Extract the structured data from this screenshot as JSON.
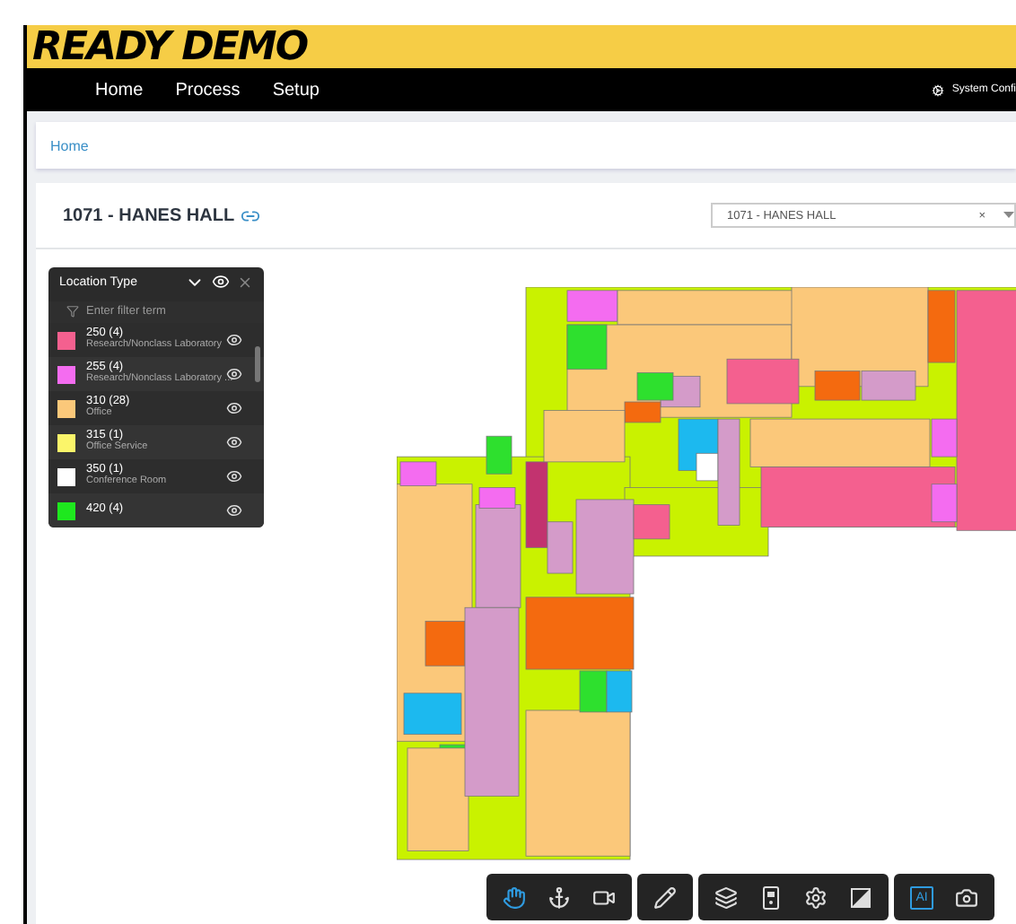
{
  "brand": "READY DEMO",
  "nav": {
    "items": [
      "Home",
      "Process",
      "Setup"
    ],
    "system": "System Confi"
  },
  "breadcrumb": [
    "Home"
  ],
  "building": {
    "title": "1071 - HANES HALL",
    "select_value": "1071 - HANES HALL",
    "clear": "×"
  },
  "legend": {
    "title": "Location Type",
    "filter_placeholder": "Enter filter term",
    "items": [
      {
        "label": "250 (4)",
        "description": "Research/Nonclass Laboratory",
        "color": "#f4608f"
      },
      {
        "label": "255 (4)",
        "description": "Research/Nonclass Laboratory ...",
        "color": "#f46cf0"
      },
      {
        "label": "310 (28)",
        "description": "Office",
        "color": "#fbc87a"
      },
      {
        "label": "315 (1)",
        "description": "Office Service",
        "color": "#fbf56a"
      },
      {
        "label": "350 (1)",
        "description": "Conference Room",
        "color": "#ffffff"
      },
      {
        "label": "420 (4)",
        "color": "#1ee81e"
      }
    ]
  },
  "toolbar": {
    "groups": [
      {
        "tools": [
          {
            "kind": "hand",
            "selected": true
          },
          {
            "kind": "anchor",
            "selected": false
          },
          {
            "kind": "video",
            "selected": false
          }
        ]
      },
      {
        "tools": [
          {
            "kind": "pencil",
            "selected": false
          }
        ]
      },
      {
        "tools": [
          {
            "kind": "layers",
            "selected": false
          },
          {
            "kind": "remote",
            "selected": false
          },
          {
            "kind": "gear",
            "selected": false
          },
          {
            "kind": "contrast",
            "selected": false
          }
        ]
      },
      {
        "tools": [
          {
            "kind": "text",
            "label": "AI",
            "selected": true
          },
          {
            "kind": "camera",
            "selected": false
          }
        ]
      }
    ]
  }
}
